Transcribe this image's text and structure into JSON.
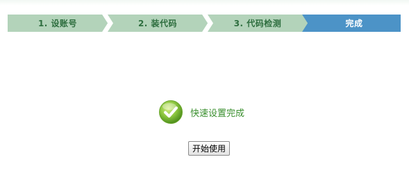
{
  "steps": [
    {
      "label": "1. 设账号",
      "state": "done"
    },
    {
      "label": "2. 装代码",
      "state": "done"
    },
    {
      "label": "3. 代码检测",
      "state": "done"
    },
    {
      "label": "完成",
      "state": "current"
    }
  ],
  "colors": {
    "step_done_bg": "#b3d3ba",
    "step_done_text": "#2e6e3f",
    "step_current_bg": "#4c93c7",
    "step_current_text": "#ffffff",
    "success_text": "#3a8f2e"
  },
  "result": {
    "icon": "check-circle-icon",
    "message": "快速设置完成"
  },
  "actions": {
    "start_label": "开始使用"
  }
}
